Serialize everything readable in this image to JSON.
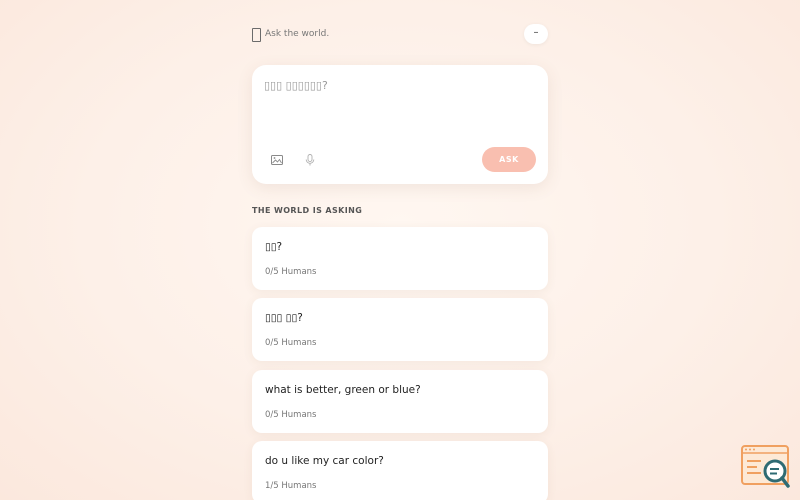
{
  "header": {
    "tagline": "Ask the world.",
    "menu_label": "–"
  },
  "ask": {
    "placeholder": "▯▯▯ ▯▯▯▯▯▯?",
    "button_label": "ASK"
  },
  "section": {
    "title": "THE WORLD IS ASKING"
  },
  "questions": [
    {
      "text": "▯▯?",
      "meta": "0/5 Humans"
    },
    {
      "text": "▯▯▯ ▯▯?",
      "meta": "0/5 Humans"
    },
    {
      "text": "what is better, green or blue?",
      "meta": "0/5 Humans"
    },
    {
      "text": "do u like my car color?",
      "meta": "1/5 Humans"
    }
  ],
  "colors": {
    "accent": "#f9bfb0",
    "badge_orange": "#f0a060",
    "badge_teal": "#2e6b73"
  },
  "icons": [
    "image-icon",
    "microphone-icon",
    "search-badge-icon"
  ]
}
